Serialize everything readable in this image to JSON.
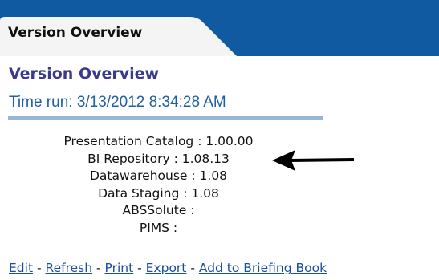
{
  "tab": {
    "label": "Version Overview"
  },
  "section": {
    "title": "Version Overview",
    "time_run": "Time run: 3/13/2012 8:34:28 AM"
  },
  "versions": [
    {
      "text": "Presentation Catalog : 1.00.00"
    },
    {
      "text": "BI Repository : 1.08.13"
    },
    {
      "text": "Datawarehouse : 1.08"
    },
    {
      "text": "Data Staging : 1.08"
    },
    {
      "text": "ABSSolute :"
    },
    {
      "text": "PIMS :"
    }
  ],
  "links": {
    "edit": "Edit",
    "refresh": "Refresh",
    "print": "Print",
    "export": "Export",
    "briefing": "Add to Briefing Book",
    "separator": "-"
  },
  "colors": {
    "tab_bar": "#0f5aa0",
    "title": "#3a3a8c",
    "link": "#1a4fa0",
    "time_run": "#1f5fa8"
  }
}
